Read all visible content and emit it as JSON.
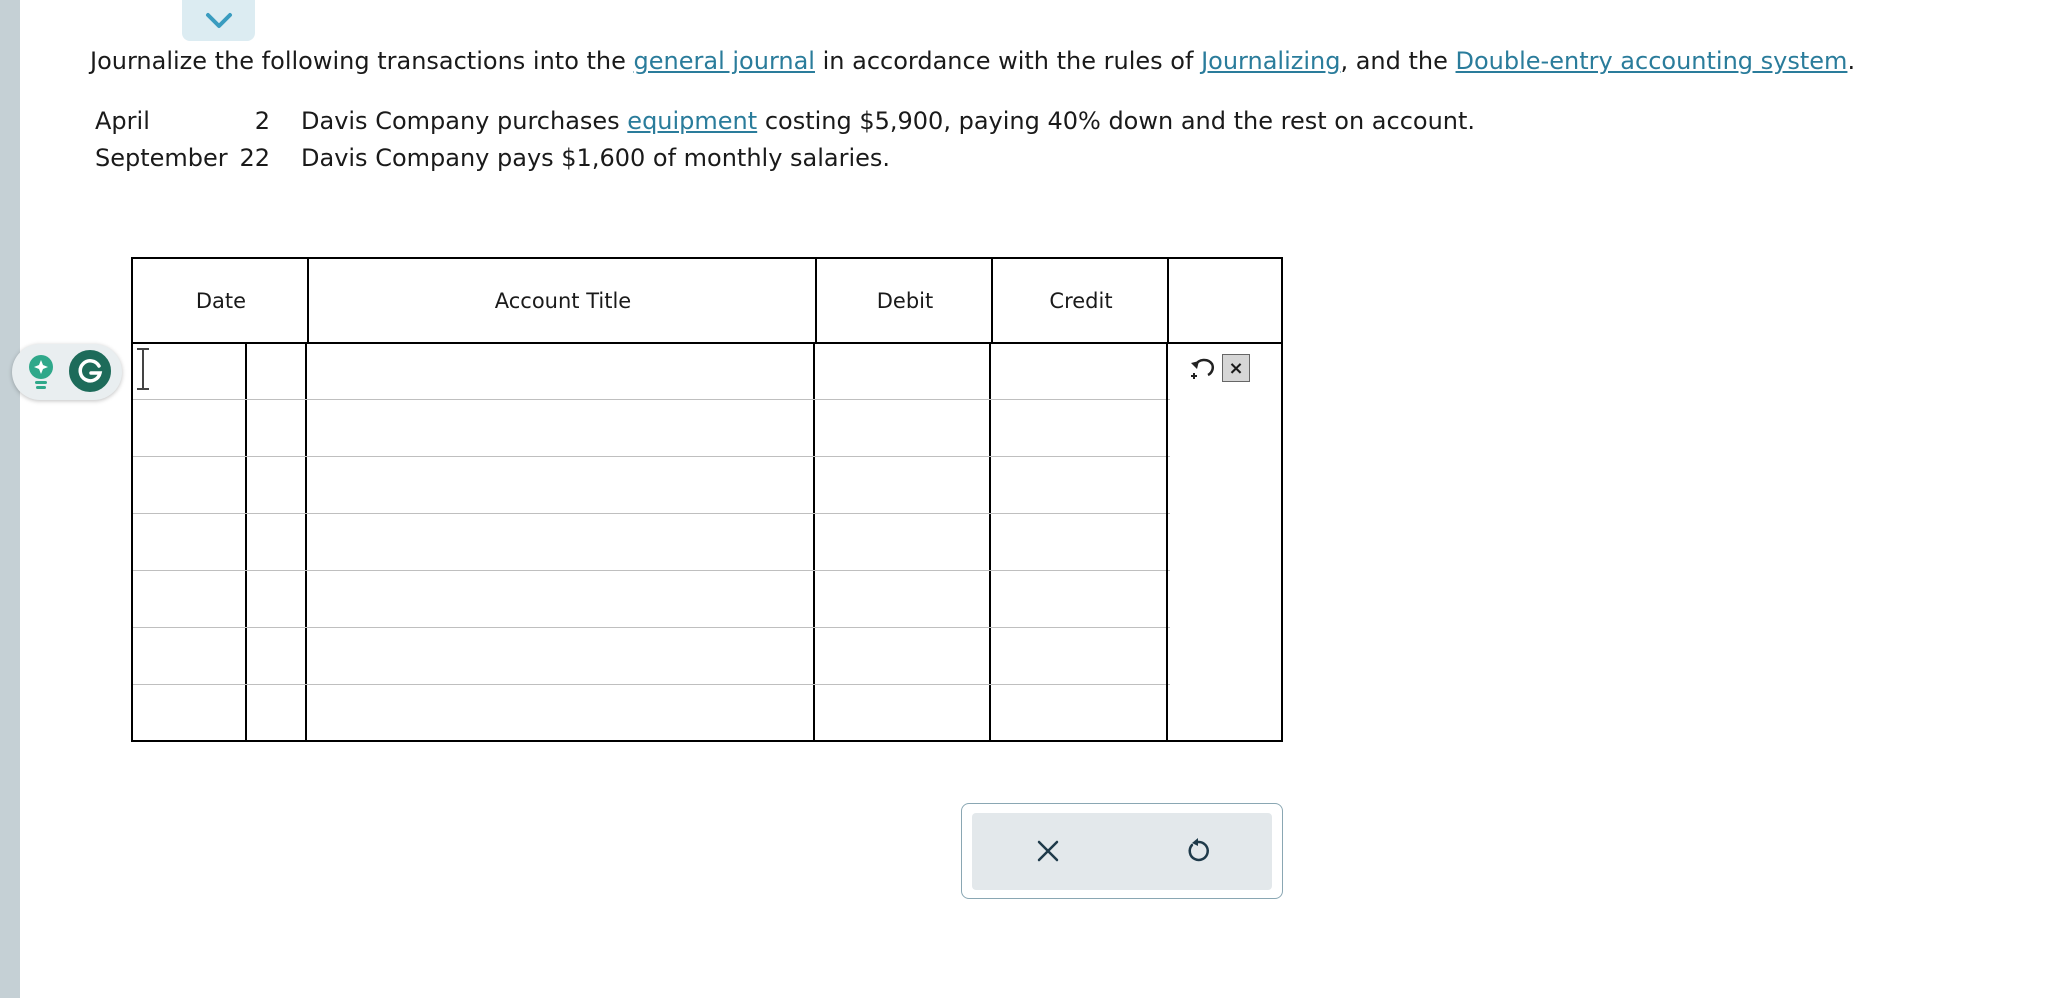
{
  "instructions": {
    "prefix": "Journalize the following transactions into the ",
    "link1": "general journal",
    "mid1": " in accordance with the rules of ",
    "link2": "Journalizing",
    "mid2": ", and the ",
    "link3": "Double-entry accounting system",
    "suffix": "."
  },
  "transactions": [
    {
      "month": "April",
      "day": "2",
      "desc_before": "Davis Company purchases ",
      "desc_link": "equipment",
      "desc_after": " costing $5,900, paying 40% down and the rest on account."
    },
    {
      "month": "September",
      "day": "22",
      "desc": "Davis Company pays $1,600 of monthly salaries."
    }
  ],
  "journal": {
    "headers": {
      "date": "Date",
      "account": "Account Title",
      "debit": "Debit",
      "credit": "Credit"
    },
    "row_count": 7
  },
  "colors": {
    "link": "#2a7c9b",
    "grammarly": "#1d6b5a",
    "rail": "#c5d0d5"
  },
  "icons": [
    "chevron-down-icon",
    "undo-icon",
    "close-icon",
    "reset-icon",
    "lightbulb-icon",
    "grammarly-icon"
  ]
}
